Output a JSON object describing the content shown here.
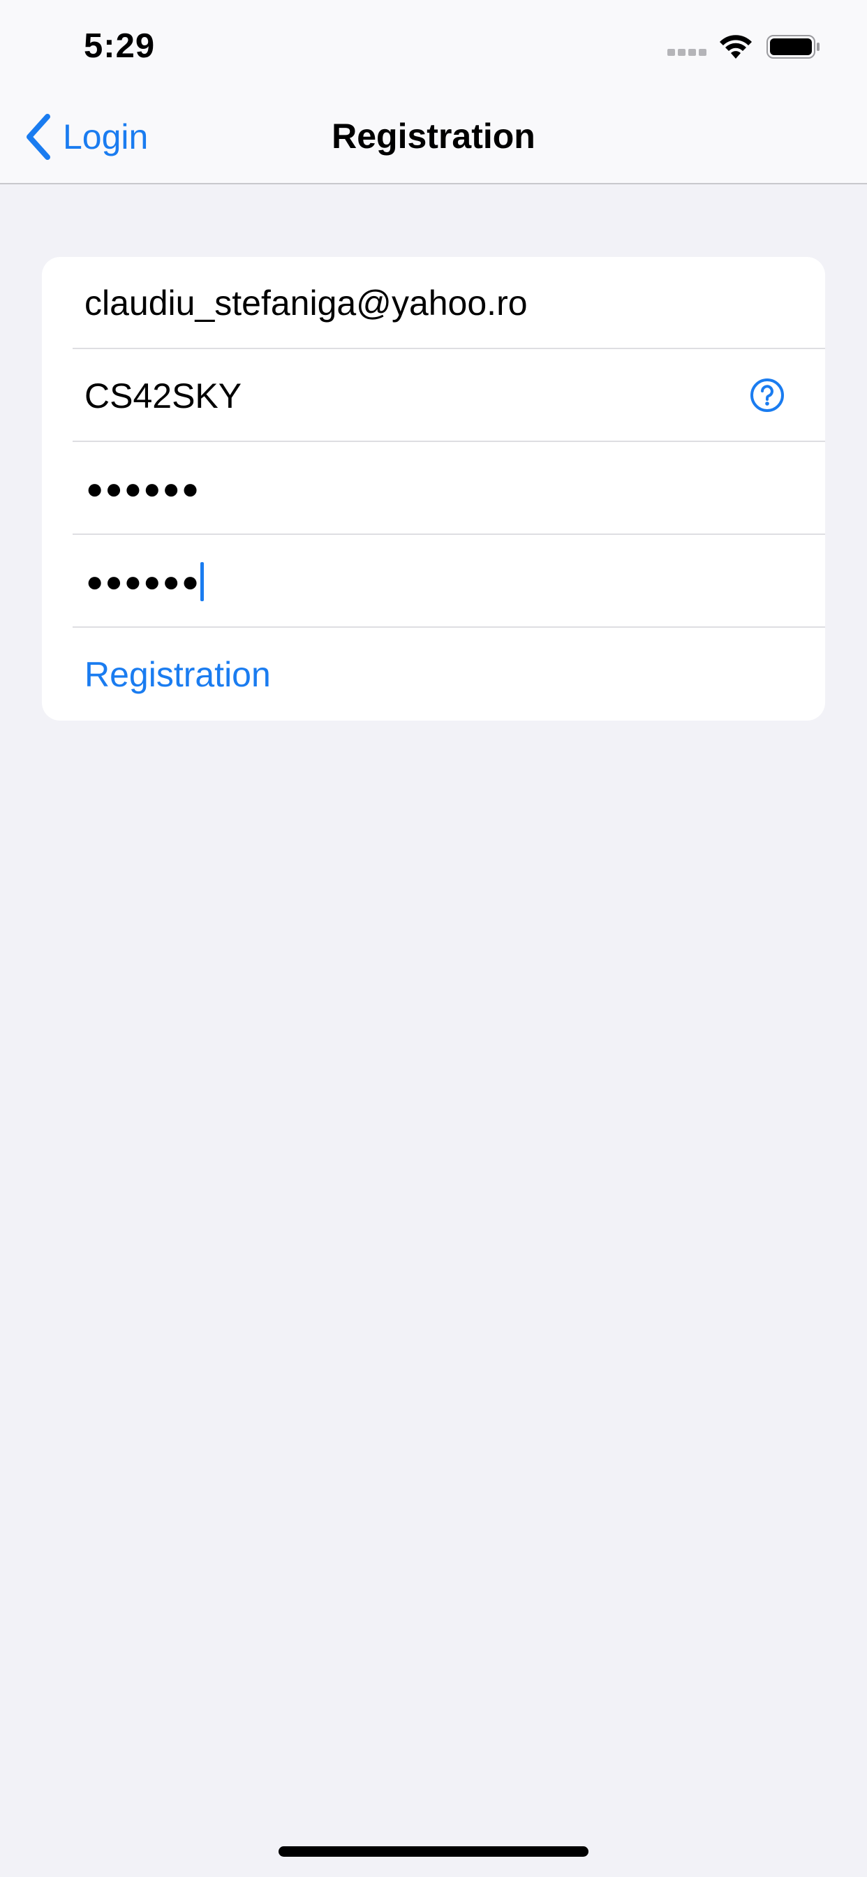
{
  "status_bar": {
    "time": "5:29",
    "signal_icon": "cellular-signal-icon",
    "wifi_icon": "wifi-icon",
    "battery_icon": "battery-icon"
  },
  "nav": {
    "back_label": "Login",
    "back_icon": "chevron-left-icon",
    "title": "Registration"
  },
  "form": {
    "email_value": "claudiu_stefaniga@yahoo.ro",
    "username_value": "CS42SKY",
    "help_icon": "question-circle-icon",
    "password_mask": "●●●●●●",
    "confirm_password_mask": "●●●●●●",
    "submit_label": "Registration"
  },
  "colors": {
    "accent": "#1a7cf0",
    "background": "#f2f2f7",
    "card": "#ffffff",
    "separator": "#dedee2"
  }
}
